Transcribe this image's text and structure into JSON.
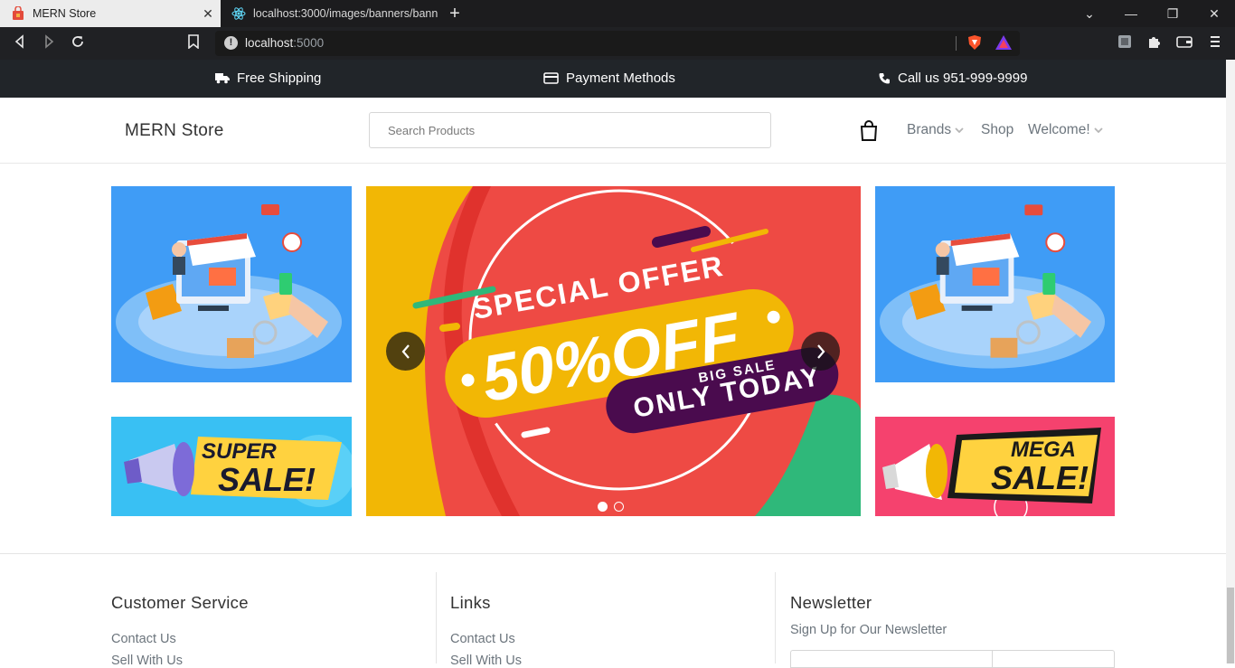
{
  "browser": {
    "tabs": [
      {
        "title": "MERN Store",
        "active": true
      },
      {
        "title": "localhost:3000/images/banners/banne",
        "active": false
      }
    ],
    "url_host": "localhost",
    "url_port": ":5000"
  },
  "promo": {
    "shipping": "Free Shipping",
    "payment": "Payment Methods",
    "call": "Call us 951-999-9999"
  },
  "header": {
    "brand": "MERN Store",
    "search_placeholder": "Search Products",
    "nav": {
      "brands": "Brands",
      "shop": "Shop",
      "welcome": "Welcome!"
    }
  },
  "carousel": {
    "special_offer": "SPECIAL OFFER",
    "percent": "50%OFF",
    "big_sale": "BIG SALE",
    "only_today": "ONLY TODAY",
    "slides": 2,
    "active_slide": 1
  },
  "banners": {
    "super_sale": [
      "SUPER",
      "SALE!"
    ],
    "mega_sale": [
      "MEGA",
      "SALE!"
    ]
  },
  "footer": {
    "customer_service": {
      "title": "Customer Service",
      "links": [
        "Contact Us",
        "Sell With Us"
      ]
    },
    "links": {
      "title": "Links",
      "links": [
        "Contact Us",
        "Sell With Us"
      ]
    },
    "newsletter": {
      "title": "Newsletter",
      "subtitle": "Sign Up for Our Newsletter"
    }
  },
  "colors": {
    "promo_bar": "#212529",
    "shop_banner_blue": "#3f9cf6",
    "offer_red": "#ee4a44",
    "offer_yellow": "#f2b705",
    "offer_purple": "#4a0b4e",
    "mega_pink": "#f5426e",
    "super_cyan": "#39c0f3"
  }
}
